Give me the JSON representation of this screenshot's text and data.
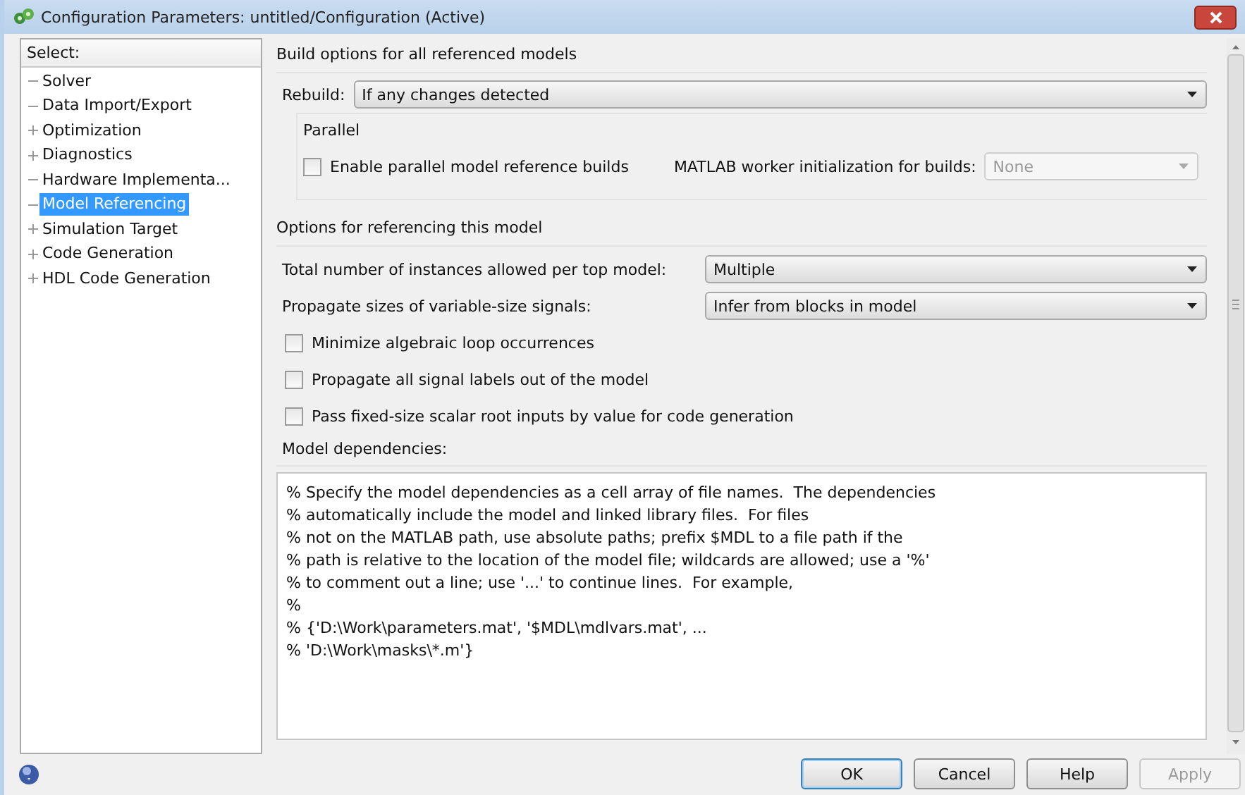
{
  "window": {
    "title": "Configuration Parameters: untitled/Configuration (Active)"
  },
  "sidebar": {
    "header": "Select:",
    "items": [
      {
        "label": "Solver",
        "kind": "leaf",
        "selected": false
      },
      {
        "label": "Data Import/Export",
        "kind": "leaf",
        "selected": false
      },
      {
        "label": "Optimization",
        "kind": "branch",
        "selected": false
      },
      {
        "label": "Diagnostics",
        "kind": "branch",
        "selected": false
      },
      {
        "label": "Hardware Implementa...",
        "kind": "leaf",
        "selected": false
      },
      {
        "label": "Model Referencing",
        "kind": "leaf",
        "selected": true
      },
      {
        "label": "Simulation Target",
        "kind": "branch",
        "selected": false
      },
      {
        "label": "Code Generation",
        "kind": "branch",
        "selected": false
      },
      {
        "label": "HDL Code Generation",
        "kind": "branch",
        "selected": false
      }
    ]
  },
  "build_options": {
    "heading": "Build options for all referenced models",
    "rebuild_label": "Rebuild:",
    "rebuild_value": "If any changes detected",
    "parallel": {
      "heading": "Parallel",
      "checkbox": {
        "label": "Enable parallel model reference builds",
        "checked": false
      },
      "worker_label": "MATLAB worker initialization for builds:",
      "worker_value": "None",
      "worker_disabled": true
    }
  },
  "referencing": {
    "heading": "Options for referencing this model",
    "dropdowns": [
      {
        "label": "Total number of instances allowed per top model:",
        "value": "Multiple"
      },
      {
        "label": "Propagate sizes of variable-size signals:",
        "value": "Infer from blocks in model"
      }
    ],
    "checkboxes": [
      {
        "label": "Minimize algebraic loop occurrences",
        "checked": false
      },
      {
        "label": "Propagate all signal labels out of the model",
        "checked": false
      },
      {
        "label": "Pass fixed-size scalar root inputs by value for code generation",
        "checked": false
      }
    ],
    "dependencies_label": "Model dependencies:",
    "dependencies_lines": [
      "% Specify the model dependencies as a cell array of file names.  The dependencies",
      "% automatically include the model and linked library files.  For files",
      "% not on the MATLAB path, use absolute paths; prefix $MDL to a file path if the",
      "% path is relative to the location of the model file; wildcards are allowed; use a '%'",
      "% to comment out a line; use '...' to continue lines.  For example,",
      "%",
      "% {'D:\\Work\\parameters.mat', '$MDL\\mdlvars.mat', ...",
      "% 'D:\\Work\\masks\\*.m'}"
    ]
  },
  "buttons": [
    {
      "label": "OK",
      "disabled": false,
      "default": true
    },
    {
      "label": "Cancel",
      "disabled": false,
      "default": false
    },
    {
      "label": "Help",
      "disabled": false,
      "default": false
    },
    {
      "label": "Apply",
      "disabled": true,
      "default": false
    }
  ]
}
